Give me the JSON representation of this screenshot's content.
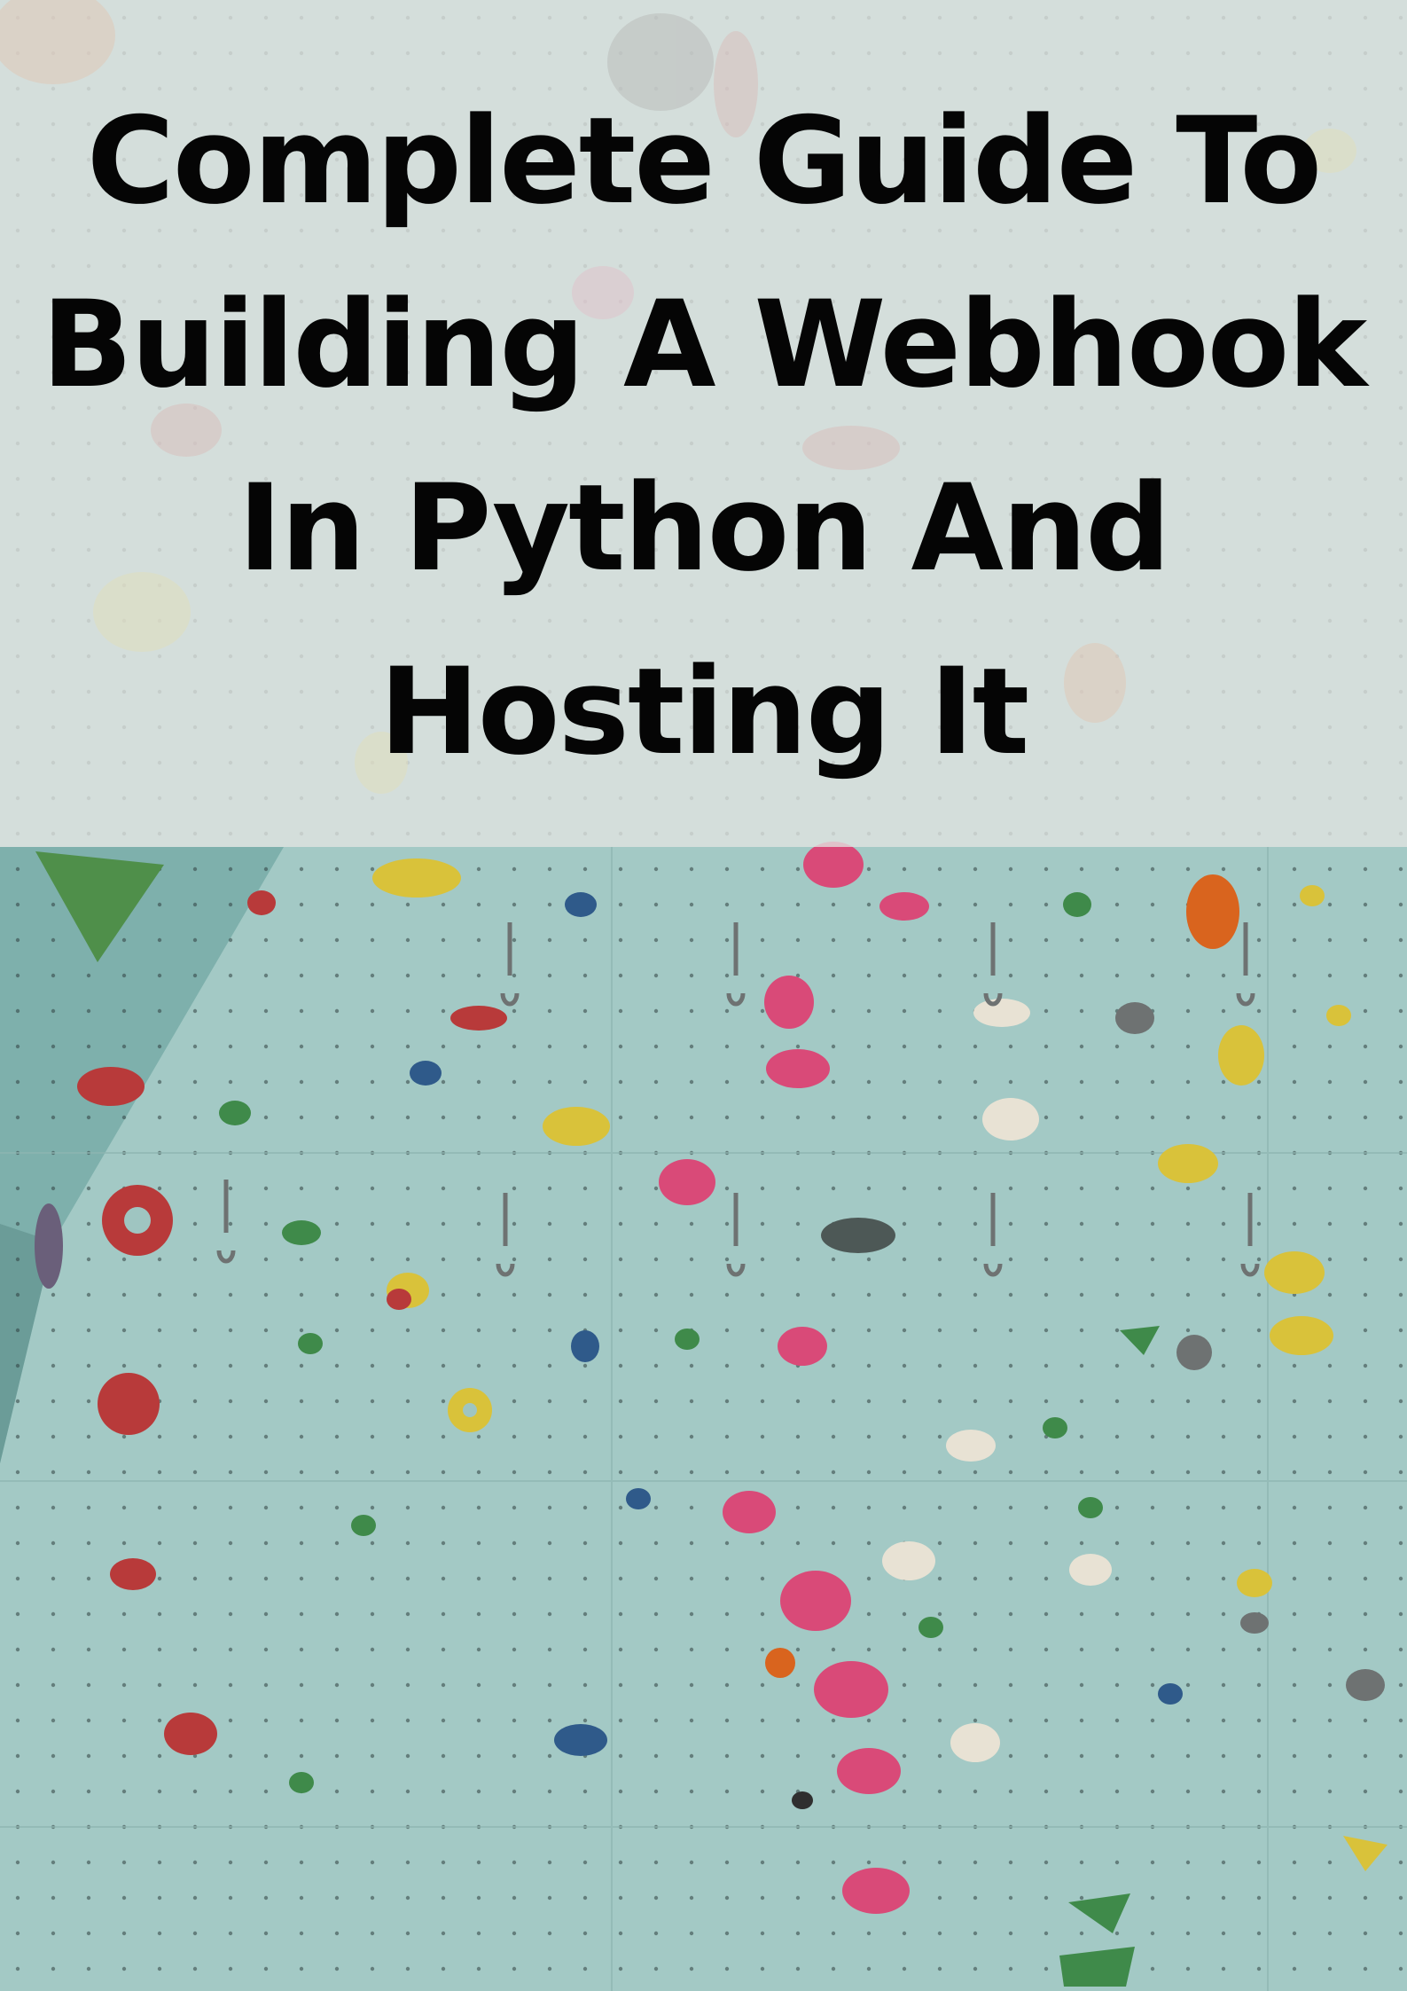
{
  "title": {
    "lines": [
      "Complete Guide To",
      "Building A Webhook",
      "In Python And",
      "Hosting It"
    ]
  },
  "image": {
    "subject": "climbing-wall",
    "colors": {
      "wall": "#9fc5c1",
      "panel_dark": "#6fa39f",
      "band": "#e2e4e2",
      "title_text": "#050505",
      "hold_red": "#b83a3a",
      "hold_pink": "#d94a78",
      "hold_yellow": "#d9c23a",
      "hold_green": "#3f8a4a",
      "hold_blue": "#2f5a8a",
      "hold_orange": "#d9641e",
      "hold_white": "#e8e2d4",
      "hold_grey": "#6e7272"
    }
  }
}
